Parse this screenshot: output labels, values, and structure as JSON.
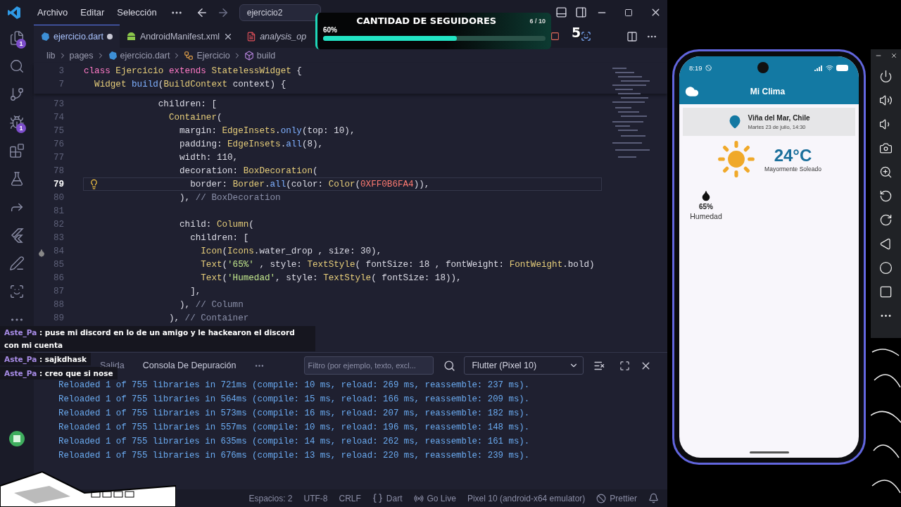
{
  "titlebar": {
    "menu": [
      "Archivo",
      "Editar",
      "Selección"
    ],
    "search": "ejercicio2"
  },
  "activity_bar": [
    {
      "kind": "explorer",
      "badge": "1"
    },
    {
      "kind": "search"
    },
    {
      "kind": "source-control"
    },
    {
      "kind": "run-debug",
      "badge": "1"
    },
    {
      "kind": "extensions"
    },
    {
      "kind": "testing"
    },
    {
      "kind": "remote"
    },
    {
      "kind": "flutter"
    },
    {
      "kind": "edit"
    },
    {
      "kind": "scan"
    },
    {
      "kind": "more"
    },
    {
      "kind": "account"
    }
  ],
  "tabs": [
    {
      "label": "ejercicio.dart",
      "kind": "dart",
      "selected": true,
      "modified": true,
      "preview": false
    },
    {
      "label": "AndroidManifest.xml",
      "kind": "android",
      "selected": false,
      "modified": false,
      "preview": false
    },
    {
      "label": "analysis_op",
      "kind": "yaml",
      "selected": false,
      "preview": true
    }
  ],
  "breadcrumb": [
    {
      "label": "lib",
      "kind": "folder"
    },
    {
      "label": "pages",
      "kind": "folder"
    },
    {
      "label": "ejercicio.dart",
      "kind": "dart"
    },
    {
      "label": "Ejercicio",
      "kind": "class"
    },
    {
      "label": "build",
      "kind": "method"
    }
  ],
  "editor": {
    "sticky_lines": [
      {
        "number": "3",
        "tokens": [
          {
            "kind": "kw",
            "text": "class "
          },
          {
            "kind": "type",
            "text": "Ejercicio "
          },
          {
            "kind": "kw",
            "text": "extends "
          },
          {
            "kind": "type",
            "text": "StatelessWidget "
          },
          {
            "kind": "plain",
            "text": "{"
          }
        ]
      },
      {
        "number": "7",
        "tokens": [
          {
            "kind": "type",
            "text": "  Widget "
          },
          {
            "kind": "fn",
            "text": "build"
          },
          {
            "kind": "plain",
            "text": "("
          },
          {
            "kind": "type",
            "text": "BuildContext "
          },
          {
            "kind": "plain",
            "text": "context) {"
          }
        ]
      }
    ],
    "lines": [
      {
        "number": "73",
        "current": false,
        "tokens": [
          {
            "kind": "plain",
            "text": "              children: ["
          }
        ]
      },
      {
        "number": "74",
        "current": false,
        "tokens": [
          {
            "kind": "type",
            "text": "                Container"
          },
          {
            "kind": "plain",
            "text": "("
          }
        ]
      },
      {
        "number": "75",
        "current": false,
        "tokens": [
          {
            "kind": "plain",
            "text": "                  margin: "
          },
          {
            "kind": "type",
            "text": "EdgeInsets"
          },
          {
            "kind": "plain",
            "text": "."
          },
          {
            "kind": "fn",
            "text": "only"
          },
          {
            "kind": "plain",
            "text": "(top: 10),"
          }
        ]
      },
      {
        "number": "76",
        "current": false,
        "tokens": [
          {
            "kind": "plain",
            "text": "                  padding: "
          },
          {
            "kind": "type",
            "text": "EdgeInsets"
          },
          {
            "kind": "plain",
            "text": "."
          },
          {
            "kind": "fn",
            "text": "all"
          },
          {
            "kind": "plain",
            "text": "(8),"
          }
        ]
      },
      {
        "number": "77",
        "current": false,
        "tokens": [
          {
            "kind": "plain",
            "text": "                  width: 110,"
          }
        ]
      },
      {
        "number": "78",
        "current": false,
        "tokens": [
          {
            "kind": "plain",
            "text": "                  decoration: "
          },
          {
            "kind": "type",
            "text": "BoxDecoration"
          },
          {
            "kind": "plain",
            "text": "("
          }
        ]
      },
      {
        "number": "79",
        "current": true,
        "kind": "lightbulb",
        "tokens": [
          {
            "kind": "plain",
            "text": "                    border: "
          },
          {
            "kind": "type",
            "text": "Border"
          },
          {
            "kind": "plain",
            "text": "."
          },
          {
            "kind": "fn",
            "text": "all"
          },
          {
            "kind": "plain",
            "text": "(color: "
          },
          {
            "kind": "type",
            "text": "Color"
          },
          {
            "kind": "plain",
            "text": "("
          },
          {
            "kind": "hex",
            "text": "0XFF0B6FA4"
          },
          {
            "kind": "plain",
            "text": ")),"
          }
        ]
      },
      {
        "number": "80",
        "current": false,
        "tokens": [
          {
            "kind": "plain",
            "text": "                  ), "
          },
          {
            "kind": "comment",
            "text": "// BoxDecoration"
          }
        ]
      },
      {
        "number": "81",
        "current": false
      },
      {
        "number": "82",
        "current": false,
        "tokens": [
          {
            "kind": "plain",
            "text": "                  child: "
          },
          {
            "kind": "type",
            "text": "Column"
          },
          {
            "kind": "plain",
            "text": "("
          }
        ]
      },
      {
        "number": "83",
        "current": false,
        "tokens": [
          {
            "kind": "plain",
            "text": "                    children: ["
          }
        ]
      },
      {
        "number": "84",
        "current": false,
        "kind": "drop",
        "tokens": [
          {
            "kind": "type",
            "text": "                      Icon"
          },
          {
            "kind": "plain",
            "text": "("
          },
          {
            "kind": "type",
            "text": "Icons"
          },
          {
            "kind": "plain",
            "text": ".water_drop , size: 30),"
          }
        ]
      },
      {
        "number": "85",
        "current": false,
        "tokens": [
          {
            "kind": "type",
            "text": "                      Text"
          },
          {
            "kind": "plain",
            "text": "("
          },
          {
            "kind": "str",
            "text": "'65%'"
          },
          {
            "kind": "plain",
            "text": " , style: "
          },
          {
            "kind": "type",
            "text": "TextStyle"
          },
          {
            "kind": "plain",
            "text": "( fontSize: 18 , fontWeight: "
          },
          {
            "kind": "type",
            "text": "FontWeight"
          },
          {
            "kind": "plain",
            "text": ".bold)"
          }
        ]
      },
      {
        "number": "86",
        "current": false,
        "tokens": [
          {
            "kind": "type",
            "text": "                      Text"
          },
          {
            "kind": "plain",
            "text": "("
          },
          {
            "kind": "str",
            "text": "'Humedad'"
          },
          {
            "kind": "plain",
            "text": ", style: "
          },
          {
            "kind": "type",
            "text": "TextStyle"
          },
          {
            "kind": "plain",
            "text": "( fontSize: 18)),"
          }
        ]
      },
      {
        "number": "87",
        "current": false,
        "tokens": [
          {
            "kind": "plain",
            "text": "                    ],"
          }
        ]
      },
      {
        "number": "88",
        "current": false,
        "tokens": [
          {
            "kind": "plain",
            "text": "                  ), "
          },
          {
            "kind": "comment",
            "text": "// Column"
          }
        ]
      },
      {
        "number": "89",
        "current": false,
        "tokens": [
          {
            "kind": "plain",
            "text": "                ), "
          },
          {
            "kind": "comment",
            "text": "// Container"
          }
        ]
      }
    ]
  },
  "panel": {
    "tabs": [
      {
        "label": "Salida",
        "selected": false
      },
      {
        "label": "Consola De Depuración",
        "selected": true
      }
    ],
    "filter_placeholder": "Filtro (por ejemplo, texto, excl...",
    "session": "Flutter (Pixel 10)",
    "console_lines": [
      "Reloaded 1 of 755 libraries in 721ms (compile: 10 ms, reload: 269 ms, reassemble: 237 ms).",
      "Reloaded 1 of 755 libraries in 564ms (compile: 15 ms, reload: 166 ms, reassemble: 209 ms).",
      "Reloaded 1 of 755 libraries in 573ms (compile: 16 ms, reload: 207 ms, reassemble: 182 ms).",
      "Reloaded 1 of 755 libraries in 557ms (compile: 10 ms, reload: 196 ms, reassemble: 148 ms).",
      "Reloaded 1 of 755 libraries in 635ms (compile: 14 ms, reload: 262 ms, reassemble: 161 ms).",
      "Reloaded 1 of 755 libraries in 676ms (compile: 13 ms, reload: 220 ms, reassemble: 239 ms)."
    ]
  },
  "status_bar": [
    {
      "kind": "text",
      "label": "Espacios: 2"
    },
    {
      "kind": "text",
      "label": "UTF-8"
    },
    {
      "kind": "text",
      "label": "CRLF"
    },
    {
      "kind": "language",
      "label": "Dart"
    },
    {
      "kind": "golive",
      "label": "Go Live"
    },
    {
      "kind": "text",
      "label": "Pixel 10 (android-x64 emulator)"
    },
    {
      "kind": "prettier",
      "label": "Prettier"
    },
    {
      "kind": "bell"
    }
  ],
  "overlay": {
    "followers": {
      "title": "CANTIDAD DE SEGUIDORES",
      "count": "6 / 10",
      "percent": "60%",
      "level": 0.6
    },
    "counter": "5",
    "chat": [
      {
        "user": "Aste_Pa",
        "text": " : puse mi discord en lo de un amigo y le hackearon el discord con mi cuenta"
      },
      {
        "user": "Aste_Pa",
        "text": " : sajkdhask"
      },
      {
        "user": "Aste_Pa",
        "text": " : creo que si nose"
      }
    ]
  },
  "phone": {
    "time": "8:19",
    "app_title": "Mi Clima",
    "location": "Viña del Mar, Chile",
    "date": "Martes 23 de julio, 14:30",
    "temperature": "24°C",
    "condition": "Mayormente Soleado",
    "humidity_value": "65%",
    "humidity_label": "Humedad"
  },
  "emulator_toolbar": [
    {
      "kind": "power"
    },
    {
      "kind": "volume-up"
    },
    {
      "kind": "volume-down"
    },
    {
      "kind": "camera"
    },
    {
      "kind": "zoom"
    },
    {
      "kind": "rotate-left"
    },
    {
      "kind": "rotate-right"
    },
    {
      "kind": "back"
    },
    {
      "kind": "home"
    },
    {
      "kind": "overview"
    },
    {
      "kind": "more"
    }
  ]
}
